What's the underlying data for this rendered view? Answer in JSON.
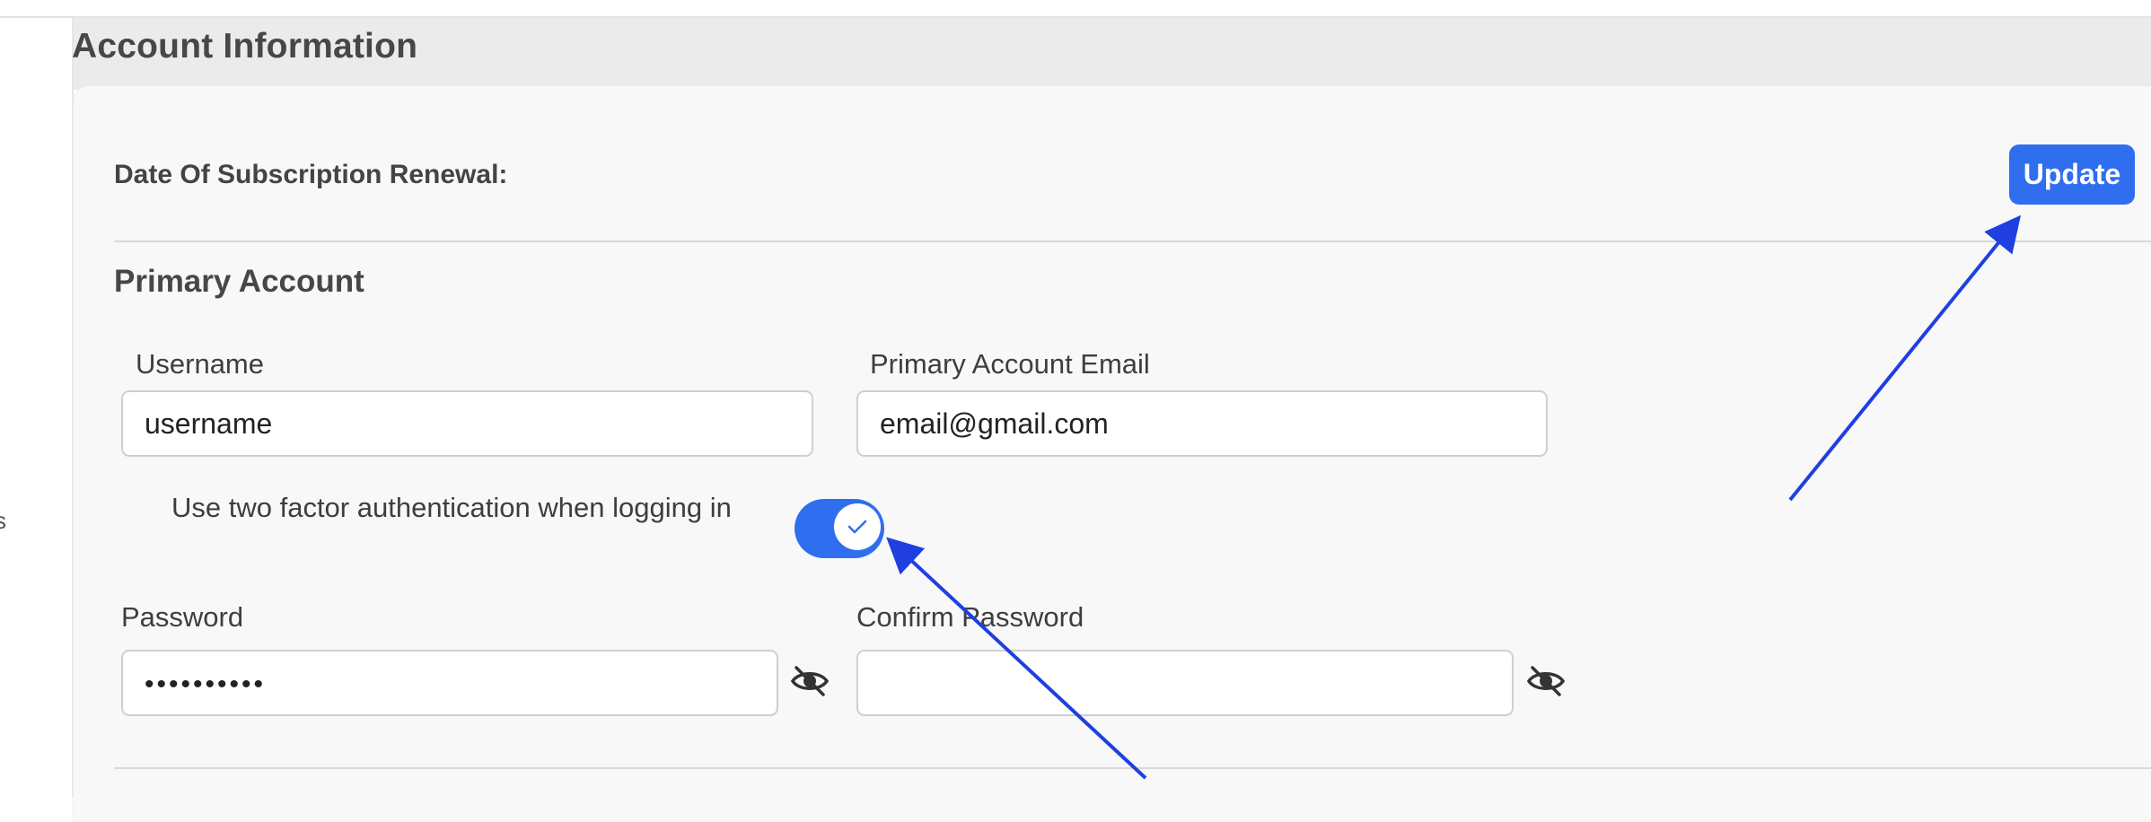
{
  "section": {
    "title": "Account Information"
  },
  "sidebar": {
    "fragment_text": "s"
  },
  "subscription": {
    "renewal_label": "Date Of Subscription Renewal:",
    "update_label": "Update"
  },
  "primary_account": {
    "title": "Primary Account",
    "username": {
      "label": "Username",
      "value": "username"
    },
    "email": {
      "label": "Primary Account Email",
      "value": "email@gmail.com"
    },
    "two_factor": {
      "label": "Use two factor authentication when logging in",
      "enabled": true
    },
    "password": {
      "label": "Password",
      "masked_value": "••••••••••",
      "visibility_icon": "eye-slash-icon"
    },
    "confirm_password": {
      "label": "Confirm Password",
      "value": "",
      "visibility_icon": "eye-slash-icon"
    }
  },
  "colors": {
    "accent": "#2f6fef",
    "annotation_arrow": "#1f3fe0",
    "header_background": "#ebebeb",
    "card_background": "#f8f8f8"
  }
}
